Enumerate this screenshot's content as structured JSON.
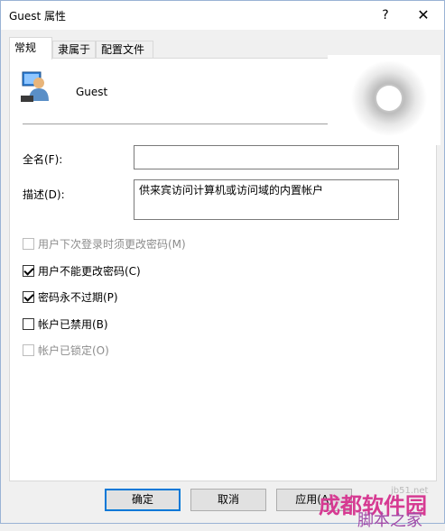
{
  "window": {
    "title": "Guest 属性",
    "help": "?",
    "close": "✕"
  },
  "tabs": [
    {
      "label": "常规",
      "active": true
    },
    {
      "label": "隶属于",
      "active": false
    },
    {
      "label": "配置文件",
      "active": false
    }
  ],
  "user": {
    "name": "Guest"
  },
  "fields": {
    "fullname_label": "全名(F):",
    "fullname_value": "",
    "desc_label": "描述(D):",
    "desc_value": "供来宾访问计算机或访问域的内置帐户"
  },
  "checkboxes": [
    {
      "label": "用户下次登录时须更改密码(M)",
      "checked": false,
      "disabled": true
    },
    {
      "label": "用户不能更改密码(C)",
      "checked": true,
      "disabled": false
    },
    {
      "label": "密码永不过期(P)",
      "checked": true,
      "disabled": false
    },
    {
      "label": "帐户已禁用(B)",
      "checked": false,
      "disabled": false
    },
    {
      "label": "帐户已锁定(O)",
      "checked": false,
      "disabled": true
    }
  ],
  "buttons": {
    "ok": "确定",
    "cancel": "取消",
    "apply": "应用(A)"
  },
  "watermark": {
    "line1": "脚本之家",
    "line2": "jb51.net",
    "line3": "成都软件园"
  },
  "colors": {
    "highlight": "#c8102e",
    "accent": "#0078d7"
  }
}
